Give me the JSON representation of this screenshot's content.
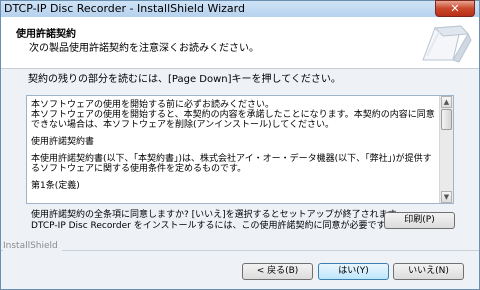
{
  "window": {
    "title": "DTCP-IP Disc Recorder - InstallShield Wizard",
    "close_label": "✕"
  },
  "header": {
    "title": "使用許諾契約",
    "subtitle": "次の製品使用許諾契約を注意深くお読みください。"
  },
  "instruction": "契約の残りの部分を読むには、[Page Down]キーを押してください。",
  "license": {
    "paragraphs": [
      "本ソフトウェアの使用を開始する前に必ずお読みください。\n本ソフトウェアの使用を開始すると、本契約の内容を承諾したことになります。本契約の内容に同意できない場合は、本ソフトウェアを削除(アンインストール)してください。",
      "使用許諾契約書",
      "本使用許諾契約書(以下、「本契約書」)は、株式会社アイ・オー・データ機器(以下、「弊社」)が提供するソフトウェアに関する使用条件を定めるものです。",
      "第1条(定義)"
    ],
    "scroll_up_icon": "▲",
    "scroll_down_icon": "▼"
  },
  "accept_question": "使用許諾契約の全条項に同意しますか? [いいえ]を選択するとセットアップが終了されます。\nDTCP-IP Disc Recorder をインストールするには、この使用許諾契約に同意が必要です。",
  "buttons": {
    "print": "印刷(P)",
    "back": "< 戻る(B)",
    "yes": "はい(Y)",
    "no": "いいえ(N)"
  },
  "footer": {
    "brand": "InstallShield"
  }
}
